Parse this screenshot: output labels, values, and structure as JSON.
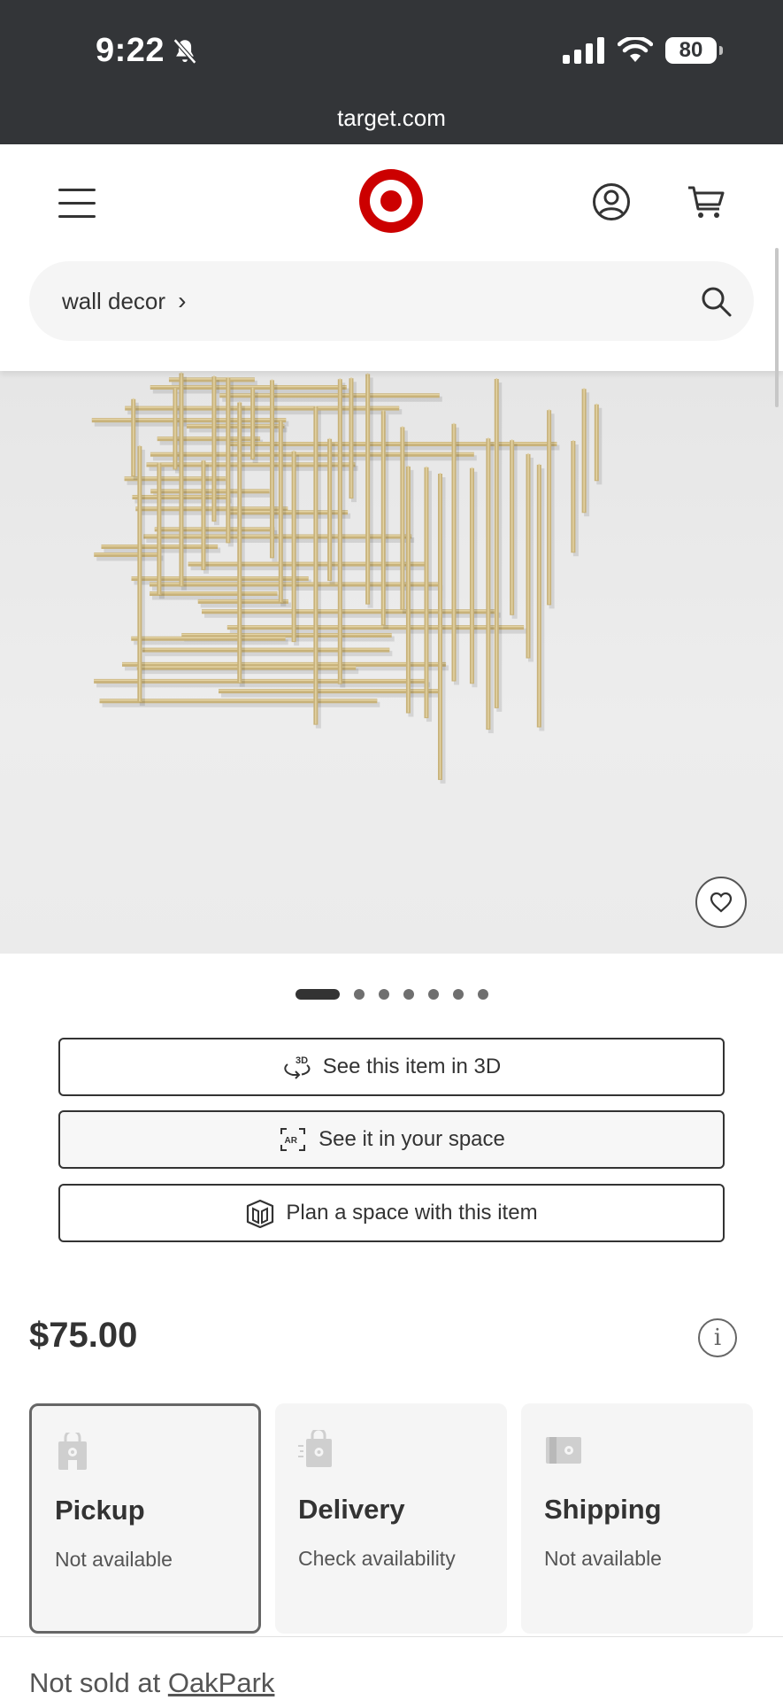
{
  "status_bar": {
    "time": "9:22",
    "battery": "80",
    "url": "target.com"
  },
  "header": {
    "search_query": "wall decor",
    "brand_color": "#cc0000"
  },
  "gallery": {
    "total_images": 7,
    "active_index": 0
  },
  "actions": {
    "view_3d": "See this item in 3D",
    "view_ar": "See it in your space",
    "plan_space": "Plan a space with this item"
  },
  "product": {
    "price": "$75.00"
  },
  "fulfillment": [
    {
      "title": "Pickup",
      "status": "Not available",
      "selected": true
    },
    {
      "title": "Delivery",
      "status": "Check availability",
      "selected": false
    },
    {
      "title": "Shipping",
      "status": "Not available",
      "selected": false
    }
  ],
  "store": {
    "prefix": "Not sold at",
    "name": "OakPark"
  }
}
